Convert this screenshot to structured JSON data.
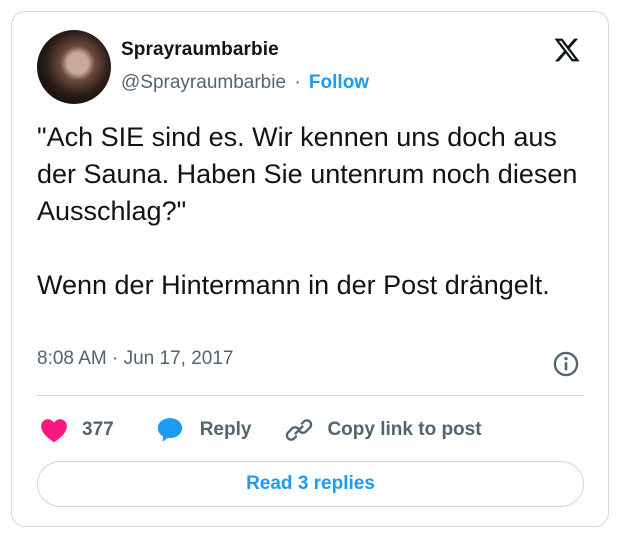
{
  "author": {
    "display_name": "Sprayraumbarbie",
    "handle": "@Sprayraumbarbie",
    "separator": "·",
    "follow_label": "Follow"
  },
  "post": {
    "paragraphs": [
      "\"Ach SIE sind es. Wir kennen uns doch aus der Sauna. Haben Sie untenrum noch diesen Ausschlag?\"",
      "Wenn der Hintermann in der Post drängelt."
    ],
    "timestamp": "8:08 AM · Jun 17, 2017"
  },
  "actions": {
    "like_count": "377",
    "reply_label": "Reply",
    "copy_link_label": "Copy link to post"
  },
  "read_replies_label": "Read 3 replies",
  "icons": {
    "platform": "x-logo-icon",
    "info": "info-icon",
    "like": "heart-icon",
    "reply": "speech-bubble-icon",
    "copy": "link-icon"
  },
  "colors": {
    "accent": "#1d9bf0",
    "like": "#f91880",
    "secondary_text": "#536471",
    "border": "#cfd9de"
  }
}
